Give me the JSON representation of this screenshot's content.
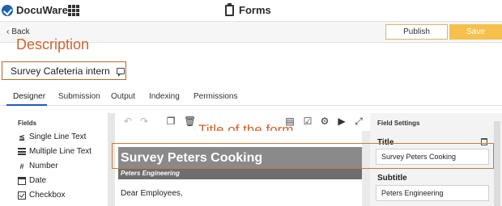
{
  "app": {
    "brand": "DocuWare",
    "section_title": "Forms"
  },
  "navigation": {
    "back_label": "Back"
  },
  "actions": {
    "publish_label": "Publish",
    "save_label": "Save"
  },
  "annotations": {
    "description": "Description",
    "title_of_form": "Title of the form"
  },
  "survey": {
    "name": "Survey Cafeteria intern"
  },
  "tabs": [
    {
      "label": "Designer",
      "active": true
    },
    {
      "label": "Submission",
      "active": false
    },
    {
      "label": "Output",
      "active": false
    },
    {
      "label": "Indexing",
      "active": false
    },
    {
      "label": "Permissions",
      "active": false
    }
  ],
  "fields_panel": {
    "heading": "Fields",
    "items": [
      {
        "label": "Single Line Text",
        "icon": "single-line-text-icon"
      },
      {
        "label": "Multiple Line Text",
        "icon": "multiple-line-text-icon"
      },
      {
        "label": "Number",
        "icon": "hash-icon"
      },
      {
        "label": "Date",
        "icon": "calendar-icon"
      },
      {
        "label": "Checkbox",
        "icon": "checkbox-icon"
      }
    ]
  },
  "form": {
    "title": "Survey Peters Cooking",
    "subtitle": "Peters Engineering",
    "greeting": "Dear Employees,"
  },
  "field_settings": {
    "heading": "Field Settings",
    "title_label": "Title",
    "title_value": "Survey Peters Cooking",
    "subtitle_label": "Subtitle",
    "subtitle_value": "Peters Engineering"
  },
  "colors": {
    "accent_blue": "#1d58c5",
    "save_button": "#f6c04d",
    "annotation_orange": "#d0632b",
    "form_header": "#8a8a8a"
  }
}
